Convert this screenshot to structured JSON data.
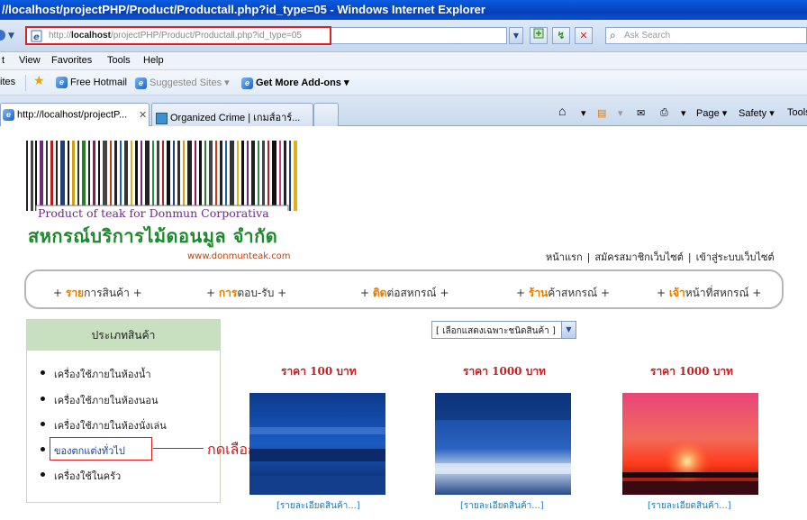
{
  "window": {
    "title": "//localhost/projectPHP/Product/Productall.php?id_type=05 - Windows Internet Explorer"
  },
  "address": {
    "url_prefix": "http://",
    "url_host": "localhost",
    "url_path": "/projectPHP/Product/Productall.php?id_type=05",
    "search_placeholder": "Ask Search"
  },
  "menu": {
    "items": [
      "t",
      "View",
      "Favorites",
      "Tools",
      "Help"
    ]
  },
  "favorites": {
    "label": "ites",
    "items": [
      "Free Hotmail",
      "Suggested Sites ▾",
      "Get More Add-ons ▾"
    ]
  },
  "tabs": {
    "items": [
      {
        "label": "http://localhost/projectP...",
        "close": "✕"
      },
      {
        "label": "Organized Crime | เกมส์อาร์..."
      }
    ],
    "tools": [
      "Page ▾",
      "Safety ▾",
      "Tools"
    ]
  },
  "site": {
    "logo_sub": "Product of teak for Donmun Corporativa",
    "logo_thai": "สหกรณ์บริการไม้ดอนมูล จำกัด",
    "logo_www": "www.donmunteak.com",
    "top_links": [
      "หน้าแรก",
      "สมัครสมาชิกเว็บไซต์",
      "เข้าสู่ระบบเว็บไซต์"
    ],
    "top_links_sep": "|",
    "nav": [
      {
        "prefix": "+ ",
        "hl": "ราย",
        "rest": "การสินค้า +"
      },
      {
        "prefix": "+ ",
        "hl": "การ",
        "rest": "ตอบ-รับ +"
      },
      {
        "prefix": "+ ",
        "hl": "ติด",
        "rest": "ต่อสหกรณ์ +"
      },
      {
        "prefix": "+ ",
        "hl": "ร้าน",
        "rest": "ค้าสหกรณ์ +"
      },
      {
        "prefix": "+ ",
        "hl": "เจ้า",
        "rest": "หน้าที่สหกรณ์ +"
      }
    ]
  },
  "sidebar": {
    "title": "ประเภทสินค้า",
    "categories": [
      "เครื่องใช้ภายในห้องน้ำ",
      "เครื่องใช้ภายในห้องนอน",
      "เครื่องใช้ภายในห้องนั่งเล่น",
      "ของตกแต่งทั่วไป",
      "เครื่องใช้ในครัว"
    ]
  },
  "annotation": {
    "callout": "กดเลือกรายการ"
  },
  "filter": {
    "selected": "[ เลือกแสดงเฉพาะชนิดสินค้า ]"
  },
  "products": [
    {
      "price": "ราคา 100 บาท",
      "detail": "[รายละเอียดสินค้า...]",
      "image": "blue-forest-night"
    },
    {
      "price": "ราคา 1000 บาท",
      "detail": "[รายละเอียดสินค้า...]",
      "image": "snowy-forest"
    },
    {
      "price": "ราคา 1000 บาท",
      "detail": "[รายละเอียดสินค้า...]",
      "image": "red-sunset"
    }
  ],
  "colors": {
    "nav_highlight": "#e47a00",
    "price": "#c81e1e",
    "annotation": "#d41a1a",
    "logo_green": "#1c8a2c",
    "sidebar_head": "#c8dfc0",
    "detail_link": "#1a7ab8"
  }
}
